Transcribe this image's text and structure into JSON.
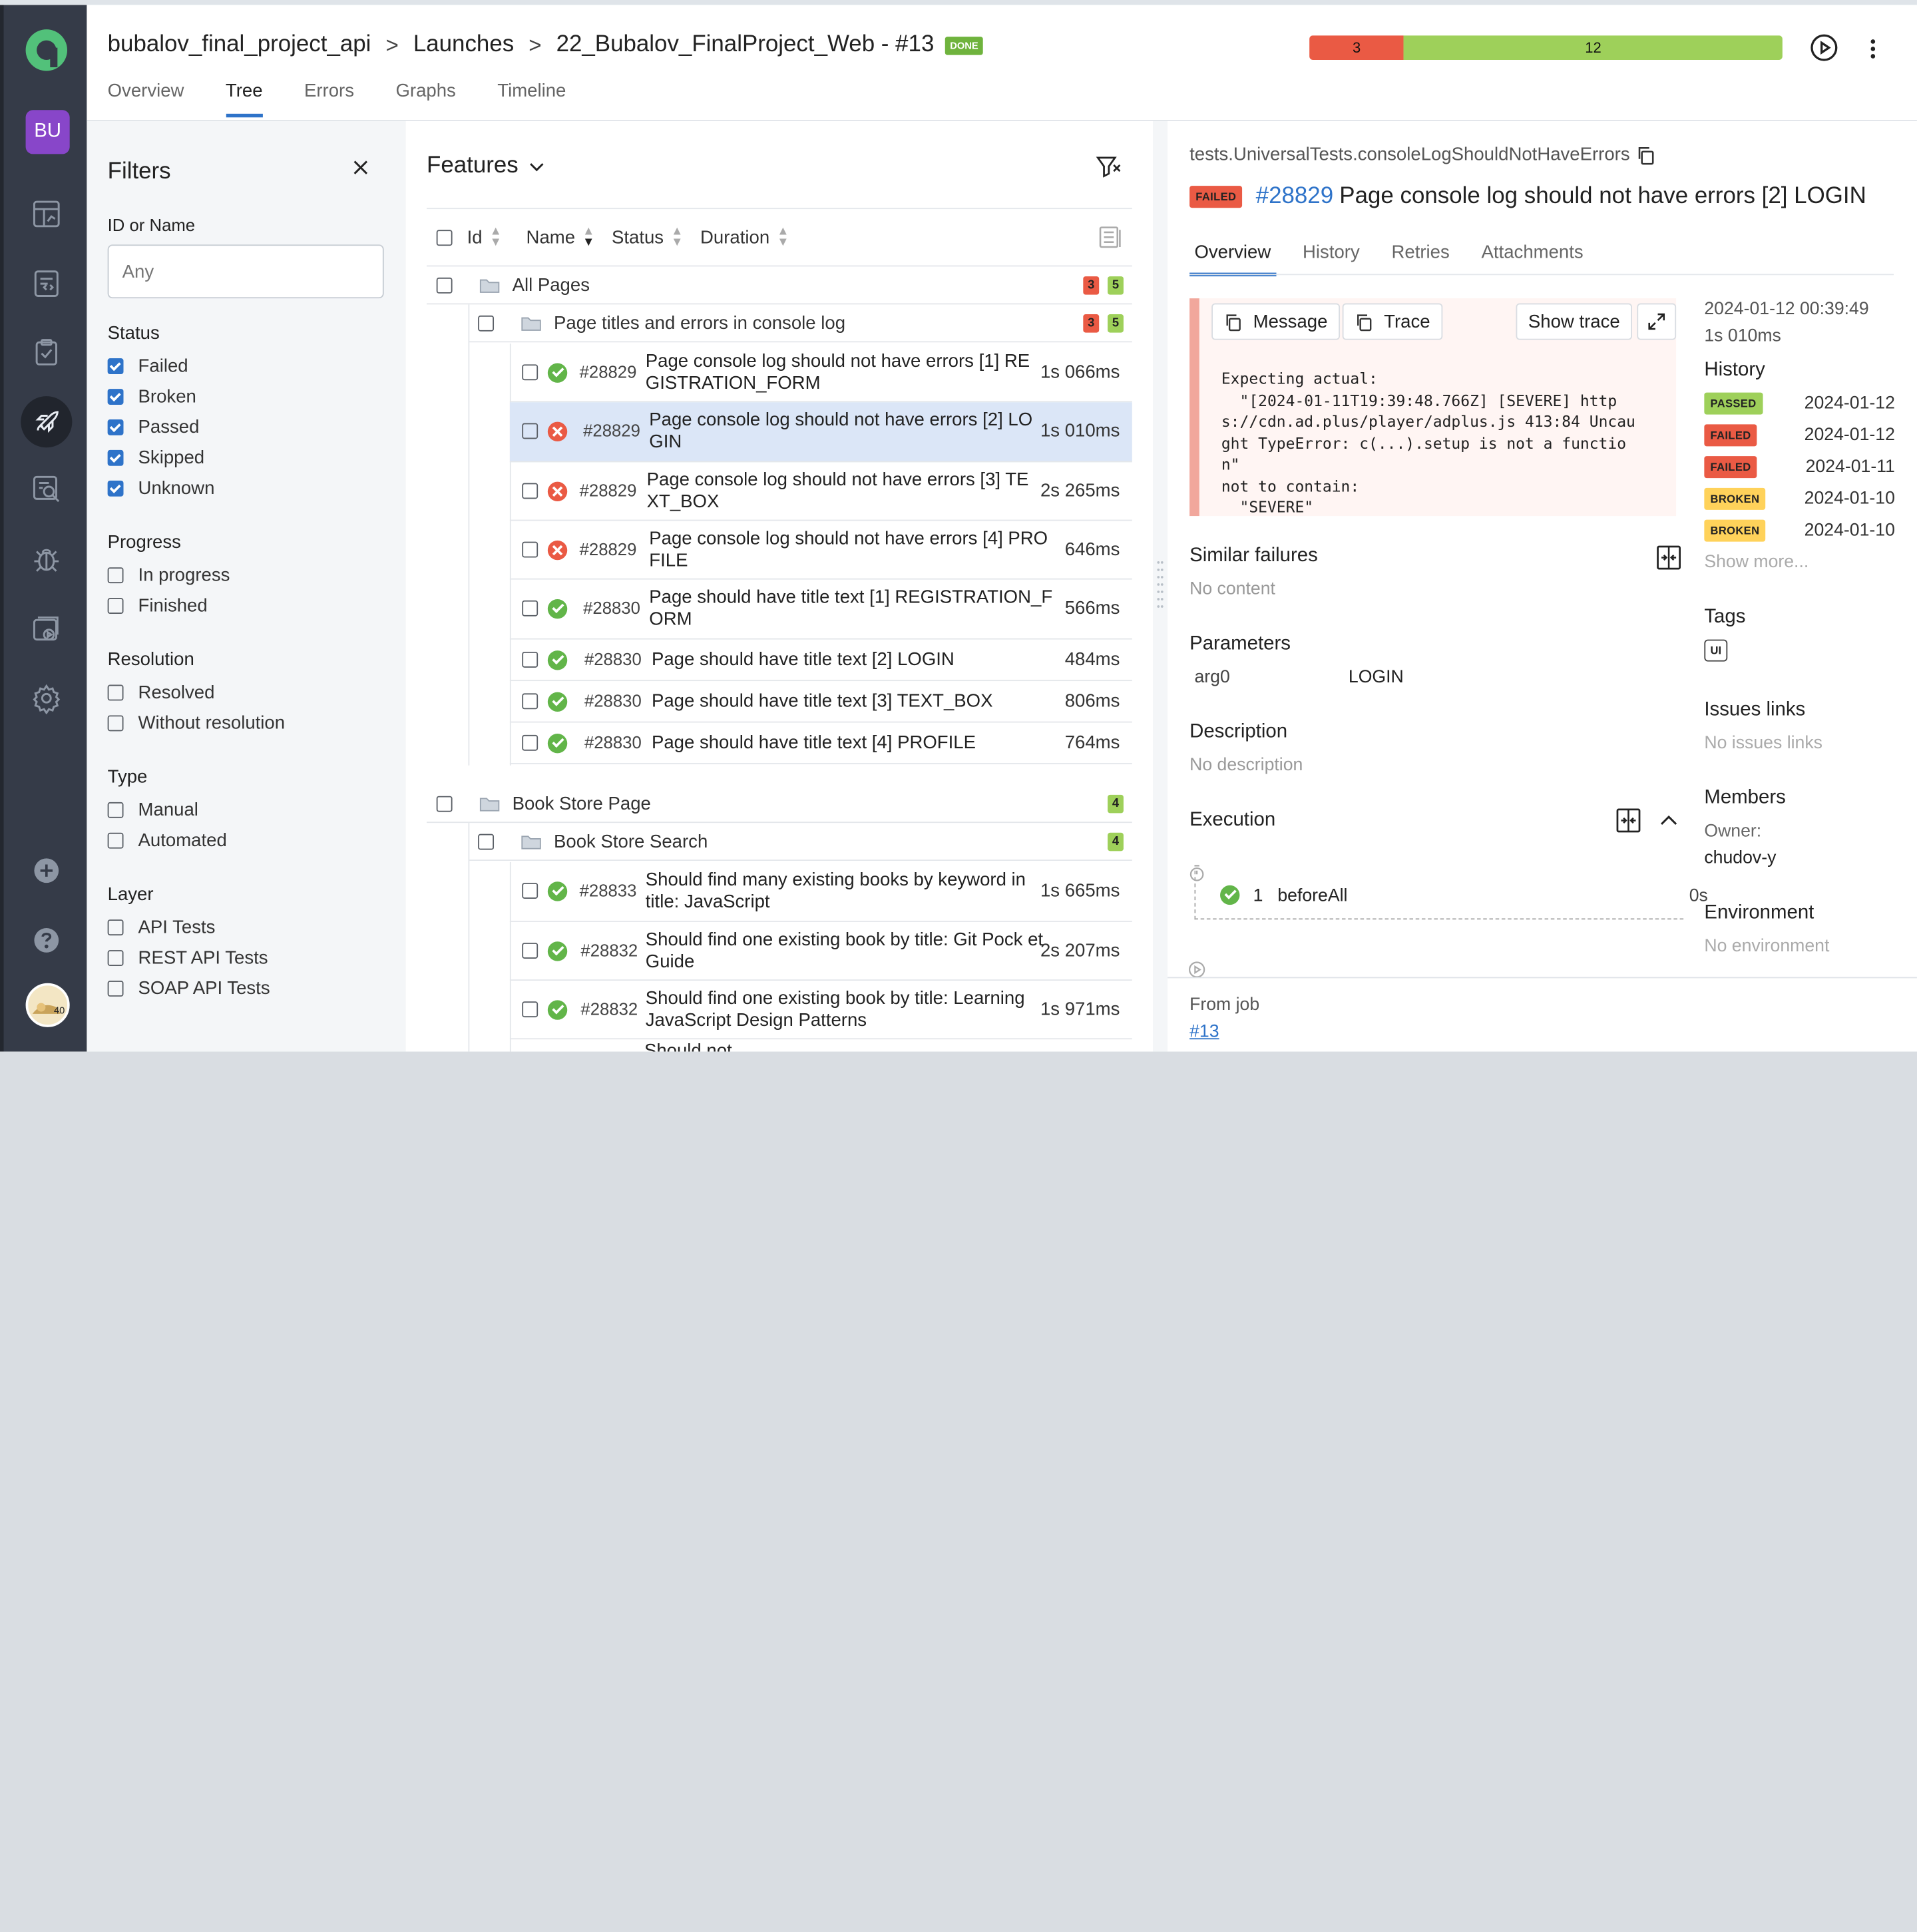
{
  "sidebar": {
    "project_initials": "BU",
    "items": [
      "dashboard-icon",
      "test-cases-icon",
      "test-plans-icon",
      "launches-icon",
      "analytics-icon",
      "defects-icon",
      "jobs-icon",
      "settings-icon"
    ],
    "bottom": [
      "add-icon",
      "help-icon"
    ],
    "avatar_text": "40"
  },
  "header": {
    "breadcrumbs": [
      "bubalov_final_project_api",
      "Launches",
      "22_Bubalov_FinalProject_Web - #13"
    ],
    "status": "DONE",
    "failed_count": "3",
    "passed_count": "12",
    "failed_share": 0.2,
    "colors": {
      "failed": "#ea5a44",
      "passed": "#9ed05a",
      "accent": "#2e73c9"
    },
    "tabs": [
      "Overview",
      "Tree",
      "Errors",
      "Graphs",
      "Timeline"
    ],
    "active_tab": "Tree"
  },
  "filters": {
    "title": "Filters",
    "id_label": "ID or Name",
    "id_placeholder": "Any",
    "groups": [
      {
        "title": "Status",
        "items": [
          {
            "label": "Failed",
            "checked": true
          },
          {
            "label": "Broken",
            "checked": true
          },
          {
            "label": "Passed",
            "checked": true
          },
          {
            "label": "Skipped",
            "checked": true
          },
          {
            "label": "Unknown",
            "checked": true
          }
        ]
      },
      {
        "title": "Progress",
        "items": [
          {
            "label": "In progress",
            "checked": false
          },
          {
            "label": "Finished",
            "checked": false
          }
        ]
      },
      {
        "title": "Resolution",
        "items": [
          {
            "label": "Resolved",
            "checked": false
          },
          {
            "label": "Without resolution",
            "checked": false
          }
        ]
      },
      {
        "title": "Type",
        "items": [
          {
            "label": "Manual",
            "checked": false
          },
          {
            "label": "Automated",
            "checked": false
          }
        ]
      },
      {
        "title": "Layer",
        "items": [
          {
            "label": "API Tests",
            "checked": false
          },
          {
            "label": "REST API Tests",
            "checked": false
          },
          {
            "label": "SOAP API Tests",
            "checked": false
          }
        ]
      }
    ]
  },
  "features": {
    "title": "Features",
    "columns": [
      "Id",
      "Name",
      "Status",
      "Duration"
    ],
    "groups": [
      {
        "name": "All Pages",
        "failed": "3",
        "passed": "5"
      },
      {
        "name": "Page titles and errors in console log",
        "failed": "3",
        "passed": "5"
      },
      {
        "name": "Book Store Page",
        "failed": "",
        "passed": "4"
      },
      {
        "name": "Book Store Search",
        "failed": "",
        "passed": "4"
      }
    ],
    "rows": [
      {
        "id": "#28829",
        "name": "Page console log should not have errors [1] RE GISTRATION_FORM",
        "duration": "1s 066ms",
        "status": "ok"
      },
      {
        "id": "#28829",
        "name": "Page console log should not have errors [2] LO GIN",
        "duration": "1s 010ms",
        "status": "bad"
      },
      {
        "id": "#28829",
        "name": "Page console log should not have errors [3] TE XT_BOX",
        "duration": "2s 265ms",
        "status": "bad"
      },
      {
        "id": "#28829",
        "name": "Page console log should not have errors [4] PRO FILE",
        "duration": "646ms",
        "status": "bad"
      },
      {
        "id": "#28830",
        "name": "Page should have title text [1] REGISTRATION_F ORM",
        "duration": "566ms",
        "status": "ok"
      },
      {
        "id": "#28830",
        "name": "Page should have title text [2] LOGIN",
        "duration": "484ms",
        "status": "ok"
      },
      {
        "id": "#28830",
        "name": "Page should have title text [3] TEXT_BOX",
        "duration": "806ms",
        "status": "ok"
      },
      {
        "id": "#28830",
        "name": "Page should have title text [4] PROFILE",
        "duration": "764ms",
        "status": "ok"
      },
      {
        "id": "#28833",
        "name": "Should find many existing books by keyword in title: JavaScript",
        "duration": "1s 665ms",
        "status": "ok"
      },
      {
        "id": "#28832",
        "name": "Should find one existing book by title: Git Pock et Guide",
        "duration": "2s 207ms",
        "status": "ok"
      },
      {
        "id": "#28832",
        "name": "Should find one existing book by title: Learning JavaScript Design Patterns",
        "duration": "1s 971ms",
        "status": "ok"
      },
      {
        "id": "",
        "name": "Should not ... ",
        "duration": "",
        "status": "ok"
      }
    ]
  },
  "details": {
    "path": "tests.UniversalTests.consoleLogShouldNotHaveErrors",
    "status": "FAILED",
    "number": "#28829",
    "title": "Page console log should not have errors [2] LOGIN",
    "tabs": [
      "Overview",
      "History",
      "Retries",
      "Attachments"
    ],
    "message_btn": "Message",
    "trace_btn": "Trace",
    "show_trace": "Show trace",
    "code": "Expecting actual:\n  \"[2024-01-11T19:39:48.766Z] [SEVERE] http\ns://cdn.ad.plus/player/adplus.js 413:84 Uncau\nght TypeError: c(...).setup is not a functio\nn\"\nnot to contain:\n  \"SEVERE\"",
    "created": "2024-01-12 00:39:49",
    "duration": "1s 010ms",
    "history_title": "History",
    "history": [
      {
        "status": "PASSED",
        "date": "2024-01-12"
      },
      {
        "status": "FAILED",
        "date": "2024-01-12"
      },
      {
        "status": "FAILED",
        "date": "2024-01-11"
      },
      {
        "status": "BROKEN",
        "date": "2024-01-10"
      },
      {
        "status": "BROKEN",
        "date": "2024-01-10"
      }
    ],
    "show_more": "Show more...",
    "tags_title": "Tags",
    "tag": "UI",
    "issues_title": "Issues links",
    "issues_empty": "No issues links",
    "members_title": "Members",
    "owner_label": "Owner:",
    "owner": "chudov-y",
    "env_title": "Environment",
    "env_empty": "No environment",
    "similar_title": "Similar failures",
    "similar_empty": "No content",
    "params_title": "Parameters",
    "param_name": "arg0",
    "param_value": "LOGIN",
    "desc_title": "Description",
    "desc_empty": "No description",
    "exec_title": "Execution",
    "exec_step_index": "1",
    "exec_step": "beforeAll",
    "exec_step_dur": "0s",
    "from_job": "From job",
    "job_link": "#13"
  }
}
